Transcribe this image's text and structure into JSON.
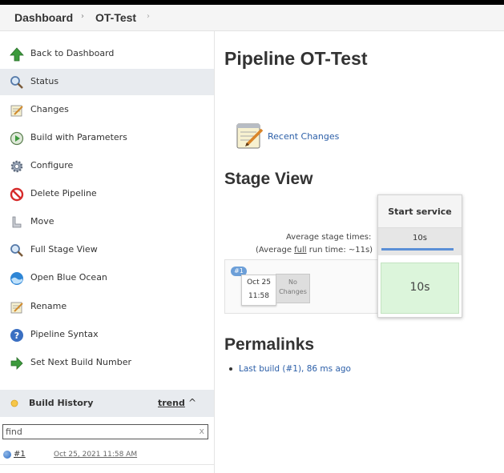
{
  "breadcrumbs": {
    "dashboard": "Dashboard",
    "sep1": "›",
    "job": "OT-Test",
    "sep2": "›"
  },
  "sidebar": {
    "tasks": [
      {
        "label": "Back to Dashboard",
        "icon": "up-arrow-icon"
      },
      {
        "label": "Status",
        "icon": "magnifier-icon"
      },
      {
        "label": "Changes",
        "icon": "notepad-icon"
      },
      {
        "label": "Build with Parameters",
        "icon": "clock-icon"
      },
      {
        "label": "Configure",
        "icon": "gear-icon"
      },
      {
        "label": "Delete Pipeline",
        "icon": "no-entry-icon"
      },
      {
        "label": "Move",
        "icon": "pipe-icon"
      },
      {
        "label": "Full Stage View",
        "icon": "magnifier-icon"
      },
      {
        "label": "Open Blue Ocean",
        "icon": "blue-ocean-icon"
      },
      {
        "label": "Rename",
        "icon": "notepad-icon"
      },
      {
        "label": "Pipeline Syntax",
        "icon": "help-icon"
      },
      {
        "label": "Set Next Build Number",
        "icon": "right-arrow-icon"
      }
    ],
    "build_history": {
      "title": "Build History",
      "trend": "trend",
      "caret": "^",
      "filter_value": "find",
      "clear": "x",
      "builds": [
        {
          "number": "#1",
          "date": "Oct 25, 2021 11:58 AM"
        }
      ]
    }
  },
  "main": {
    "title": "Pipeline OT-Test",
    "recent_changes": "Recent Changes",
    "stage_view_heading": "Stage View",
    "avg_stage_times": "Average stage times:",
    "avg_run_prefix": "(Average ",
    "avg_run_full": "full",
    "avg_run_suffix": " run time: ~11s)",
    "stage_name": "Start service",
    "stage_avg": "10s",
    "stage_cell": "10s",
    "build_badge": "#1",
    "build_date": "Oct 25",
    "build_time": "11:58",
    "no_changes_1": "No",
    "no_changes_2": "Changes",
    "permalinks_heading": "Permalinks",
    "permalinks": [
      "Last build (#1), 86 ms ago"
    ]
  },
  "colors": {
    "accent_link": "#2c5fa8",
    "success_cell": "#dcf5db",
    "active_task": "#e8ebef"
  }
}
